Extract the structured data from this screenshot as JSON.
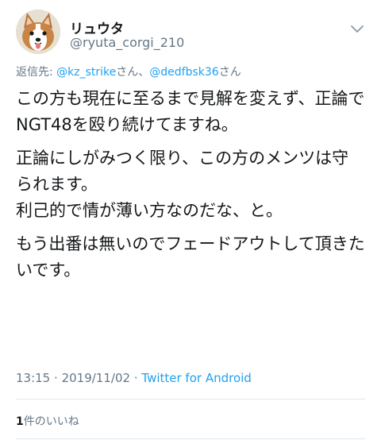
{
  "tweet": {
    "display_name": "リュウタ",
    "handle": "@ryuta_corgi_210",
    "reply_prefix": "返信先: ",
    "reply_mentions": [
      {
        "text": "@kz_strike",
        "suffix": "さん、"
      },
      {
        "text": "@dedfbsk36",
        "suffix": "さん"
      }
    ],
    "paragraphs": [
      "この方も現在に至るまで見解を変えず、正論でNGT48を殴り続けてますね。",
      "正論にしがみつく限り、この方のメンツは守られます。\n利己的で情が薄い方なのだな、と。",
      "もう出番は無いのでフェードアウトして頂きたいです。"
    ],
    "time": "13:15",
    "separator": "·",
    "date": "2019/11/02",
    "source": "Twitter for Android",
    "like_count": "1",
    "like_label": "件のいいね"
  },
  "icons": {
    "menu": "chevron-down-icon",
    "avatar": "corgi-avatar"
  },
  "colors": {
    "link": "#1da1f2",
    "secondary": "#657786",
    "text": "#14171a",
    "divider": "#e1e8ed"
  }
}
